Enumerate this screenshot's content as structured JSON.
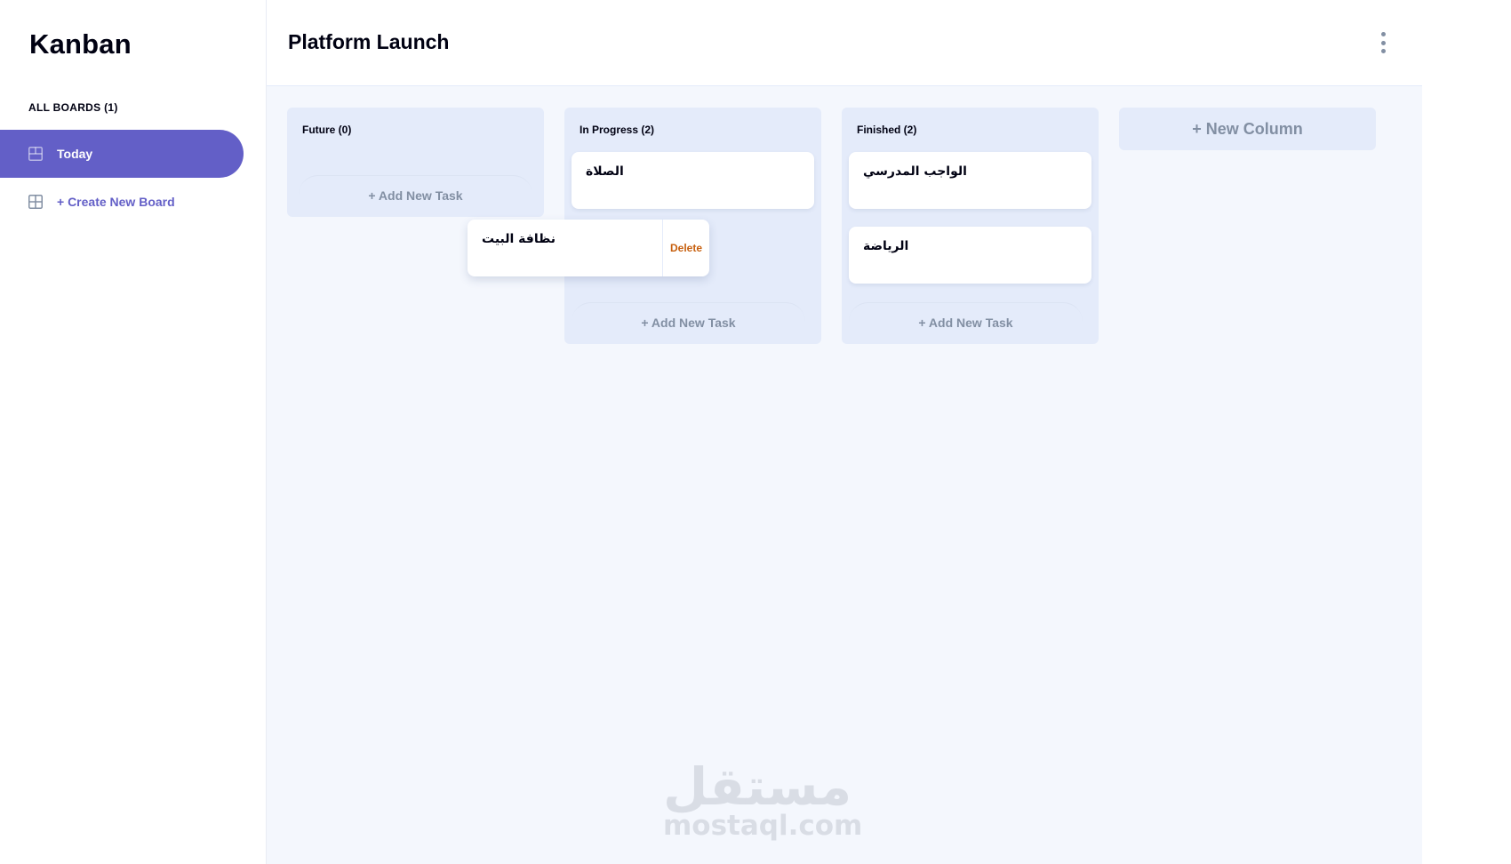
{
  "app": {
    "logo": "Kanban"
  },
  "sidebar": {
    "boards_heading": "ALL BOARDS (1)",
    "boards": [
      {
        "label": "Today",
        "active": true
      }
    ],
    "create_board_label": "+ Create New Board"
  },
  "header": {
    "board_title": "Platform Launch"
  },
  "columns": [
    {
      "title": "Future (0)",
      "tasks": [],
      "add_task_label": "+ Add New Task"
    },
    {
      "title": "In Progress (2)",
      "tasks": [
        {
          "title": "الصلاة"
        }
      ],
      "add_task_label": "+ Add New Task"
    },
    {
      "title": "Finished (2)",
      "tasks": [
        {
          "title": "الواجب المدرسي"
        },
        {
          "title": "الرياضة"
        }
      ],
      "add_task_label": "+ Add New Task"
    }
  ],
  "dragged_task": {
    "title": "نظافة البيت",
    "delete_label": "Delete"
  },
  "new_column_label": "+ New Column",
  "watermark": {
    "arabic": "مستقل",
    "latin": "mostaql.com"
  },
  "colors": {
    "accent": "#635fc7",
    "board_bg": "#f4f7fd",
    "column_bg": "#e4ebfa",
    "muted_text": "#828fa3",
    "delete": "#c7600f"
  }
}
